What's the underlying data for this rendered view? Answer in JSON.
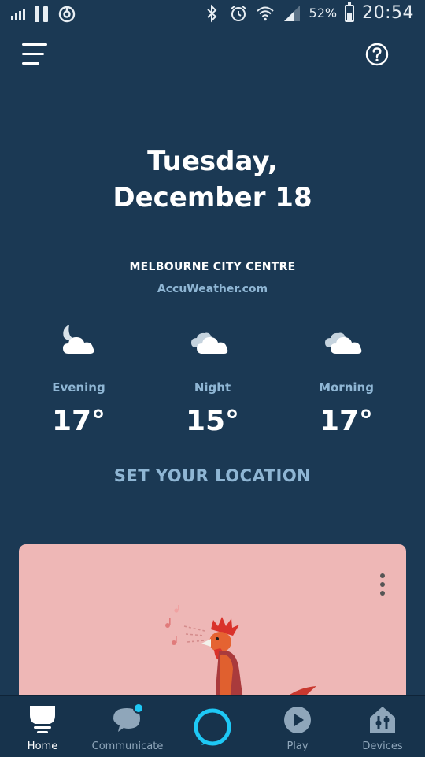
{
  "status_bar": {
    "battery_percent": "52%",
    "time": "20:54",
    "icons": [
      "signal-icon",
      "pause-icon",
      "sync-icon",
      "bluetooth-icon",
      "alarm-icon",
      "wifi-icon",
      "cellular-icon",
      "battery-icon"
    ]
  },
  "header": {
    "menu_icon": "menu-icon",
    "help_icon": "help-icon"
  },
  "date": {
    "line1": "Tuesday,",
    "line2": "December 18"
  },
  "weather": {
    "location": "MELBOURNE CITY CENTRE",
    "source": "AccuWeather.com",
    "forecast": [
      {
        "period": "Evening",
        "temp": "17°",
        "icon": "moon-cloud-icon"
      },
      {
        "period": "Night",
        "temp": "15°",
        "icon": "cloudy-night-icon"
      },
      {
        "period": "Morning",
        "temp": "17°",
        "icon": "cloudy-icon"
      }
    ],
    "set_location": "SET YOUR LOCATION"
  },
  "card": {
    "background": "#eeb7b6",
    "illustration": "rooster-illustration"
  },
  "nav": {
    "items": [
      {
        "label": "Home",
        "icon": "home-icon",
        "active": true
      },
      {
        "label": "Communicate",
        "icon": "chat-bubble-icon",
        "active": false,
        "badge": true
      },
      {
        "label": "",
        "icon": "alexa-ring-icon",
        "active": false
      },
      {
        "label": "Play",
        "icon": "play-icon",
        "active": false
      },
      {
        "label": "Devices",
        "icon": "devices-icon",
        "active": false
      }
    ]
  },
  "colors": {
    "background": "#1b3954",
    "accent": "#1ec8f5",
    "muted_text": "#8fb6d4"
  }
}
